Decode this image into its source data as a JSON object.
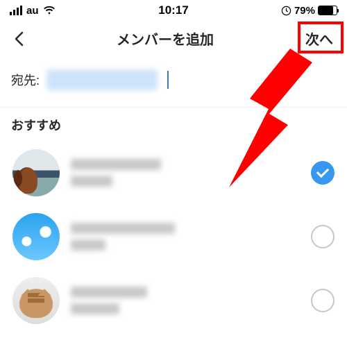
{
  "statusbar": {
    "carrier": "au",
    "time": "10:17",
    "battery_text": "79%"
  },
  "nav": {
    "title": "メンバーを追加",
    "next_label": "次へ"
  },
  "compose": {
    "to_label": "宛先:"
  },
  "section": {
    "suggested": "おすすめ"
  },
  "list": {
    "items": [
      {
        "selected": true,
        "avatar": "dog"
      },
      {
        "selected": false,
        "avatar": "sky"
      },
      {
        "selected": false,
        "avatar": "cat"
      }
    ]
  },
  "annotation": {
    "highlight_target": "next-button",
    "arrow_color": "red"
  }
}
